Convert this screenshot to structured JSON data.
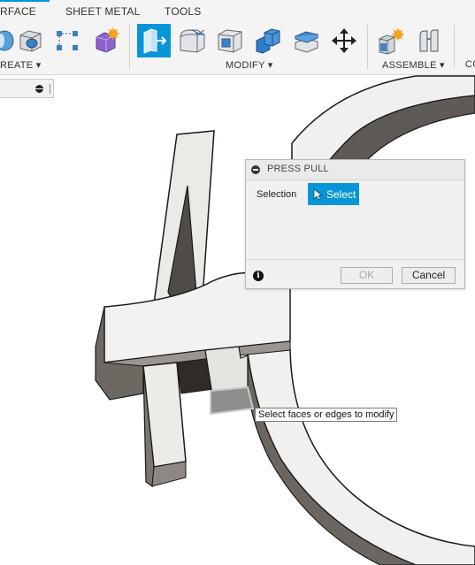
{
  "toolbar": {
    "tabs": [
      {
        "label": "RFACE"
      },
      {
        "label": "SHEET METAL"
      },
      {
        "label": "TOOLS"
      }
    ],
    "groups": {
      "create": "REATE ▾",
      "modify": "MODIFY ▾",
      "assemble": "ASSEMBLE ▾",
      "construct": "CO"
    },
    "icons": {
      "create": [
        "revolve-icon",
        "hole-icon",
        "pattern-icon",
        "create-form-icon"
      ],
      "modify": [
        "press-pull-icon",
        "fillet-icon",
        "shell-icon",
        "combine-icon",
        "replace-face-icon",
        "move-icon"
      ],
      "assemble": [
        "new-component-icon",
        "joint-icon"
      ]
    },
    "active_tool": "press-pull-icon",
    "accent_color": "#0696d7"
  },
  "dialog": {
    "title": "PRESS PULL",
    "selection_label": "Selection",
    "select_button": "Select",
    "ok_button": "OK",
    "cancel_button": "Cancel"
  },
  "tooltip": {
    "text": "Select faces or edges to modify"
  }
}
